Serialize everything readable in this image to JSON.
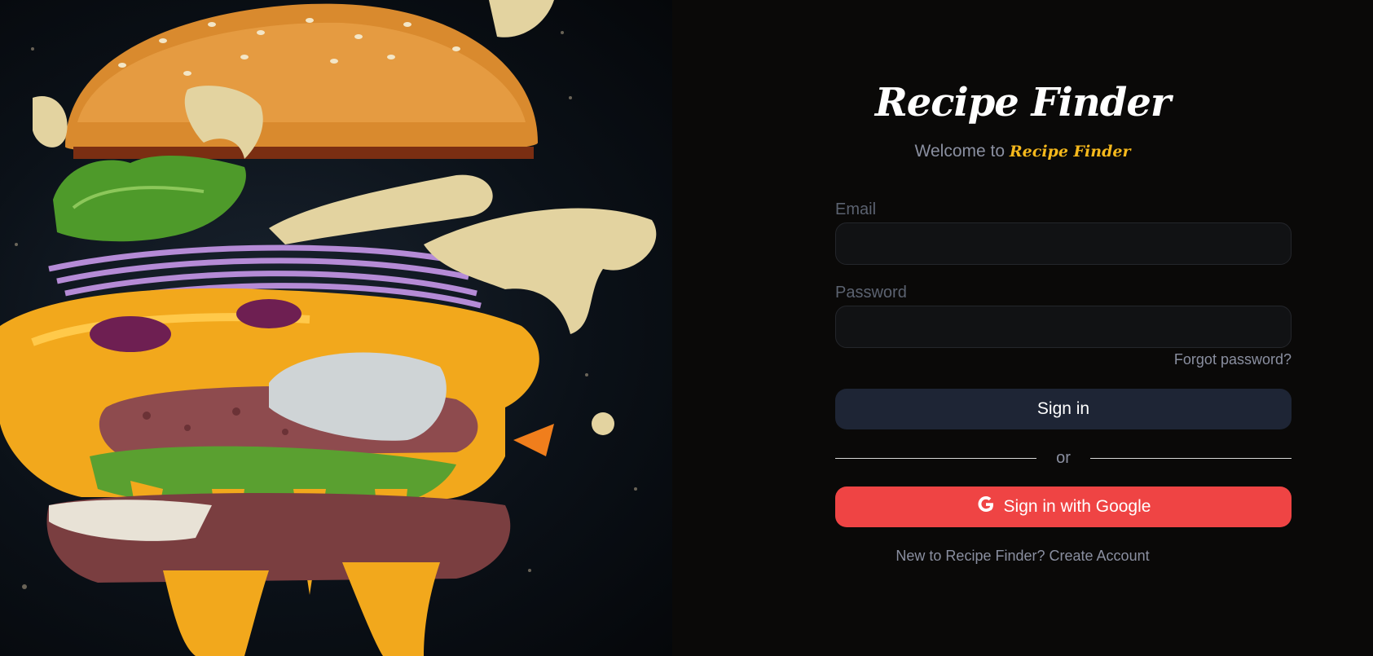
{
  "brand": {
    "title": "Recipe Finder"
  },
  "welcome": {
    "prefix": "Welcome to",
    "accent": "Recipe Finder"
  },
  "form": {
    "email_label": "Email",
    "email_value": "",
    "password_label": "Password",
    "password_value": "",
    "forgot_label": "Forgot password?",
    "signin_label": "Sign in",
    "divider_label": "or",
    "google_label": "Sign in with Google"
  },
  "footer": {
    "prompt": "New to Recipe Finder?",
    "link": "Create Account"
  },
  "colors": {
    "accent": "#f5b81c",
    "google_button": "#ef4444",
    "signin_button": "#1e2535",
    "background": "#0a0908"
  },
  "hero": {
    "image_subject": "burger-illustration"
  }
}
